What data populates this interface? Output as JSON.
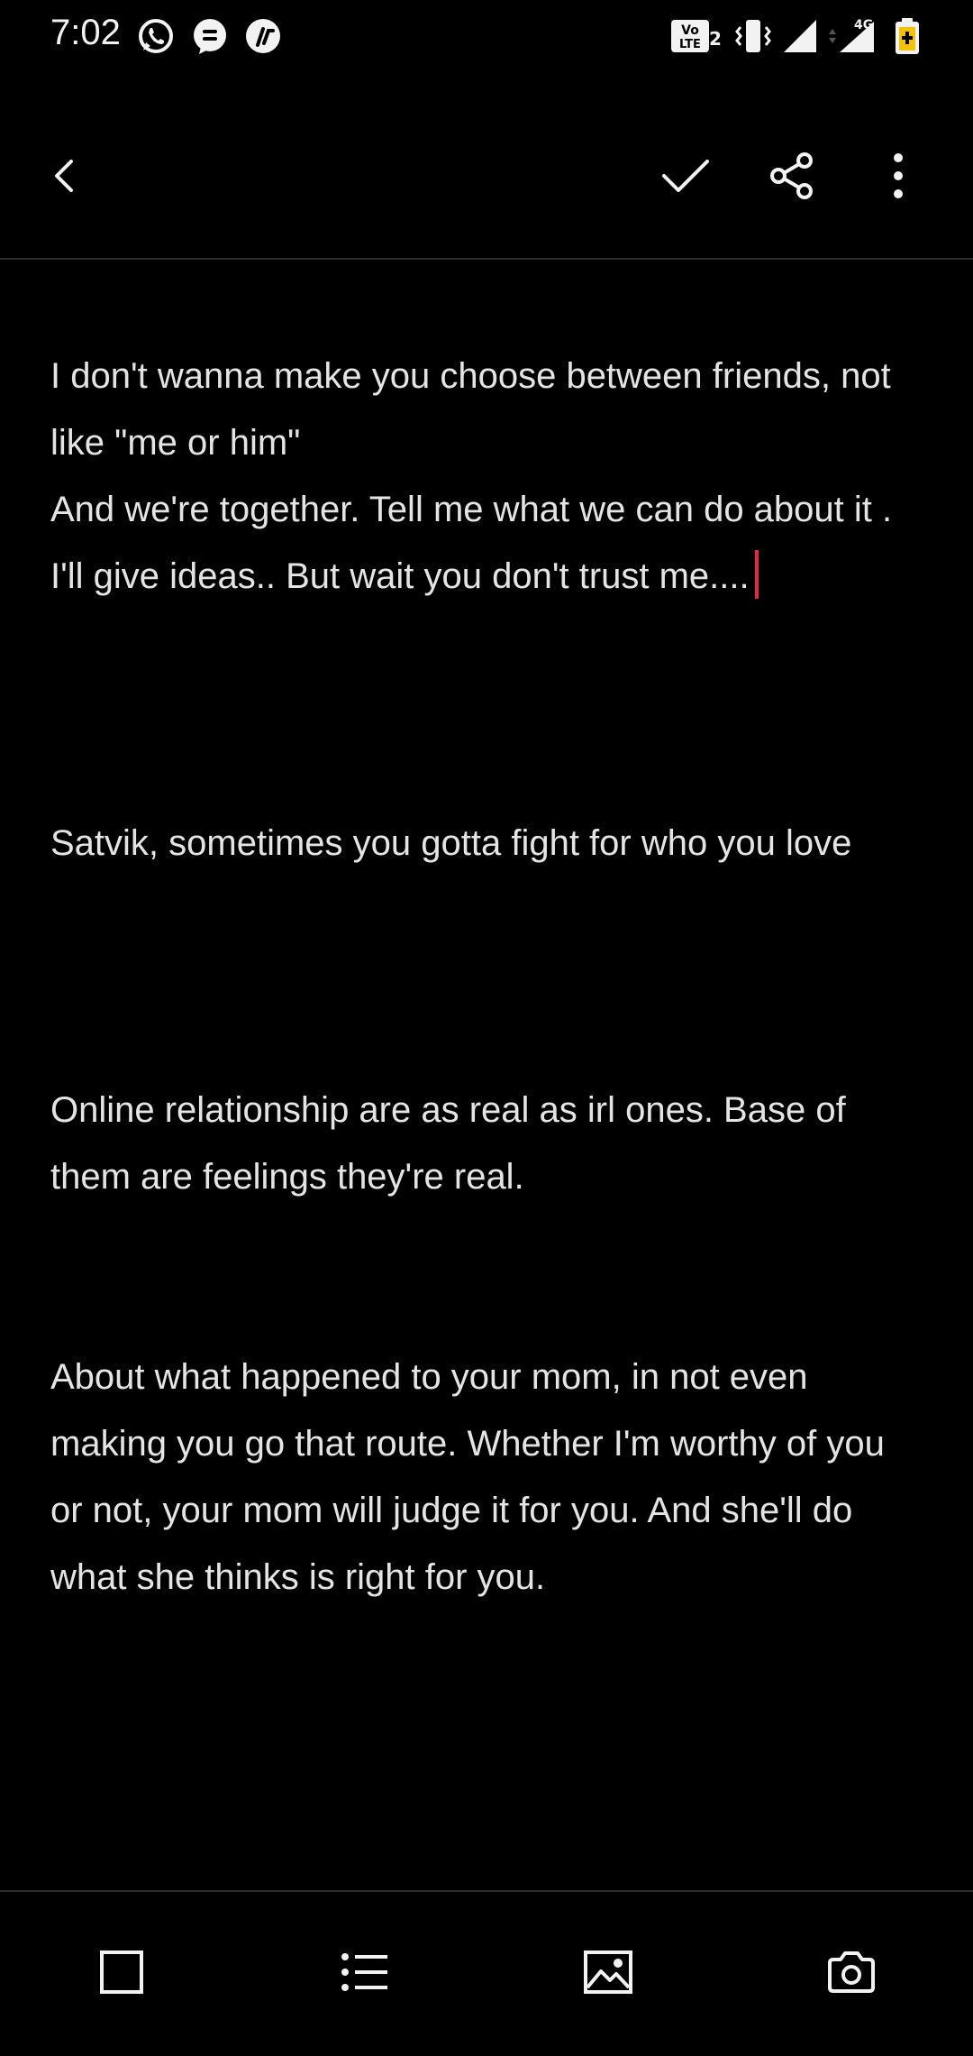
{
  "status_bar": {
    "time": "7:02",
    "left_icons": [
      "whatsapp-icon",
      "message-icon",
      "app-icon"
    ],
    "right_icons": [
      "volte-icon",
      "vibrate-icon",
      "signal-icon",
      "signal-4g-icon",
      "battery-icon"
    ],
    "network_label": "4G",
    "volte_label": "Vo LTE 2"
  },
  "toolbar": {
    "back_icon": "back-arrow-icon",
    "done_icon": "check-icon",
    "share_icon": "share-icon",
    "more_icon": "more-vert-icon"
  },
  "note": {
    "paragraphs": [
      "I don't wanna make you choose between friends, not like \"me or him\"\nAnd we're together. Tell me what we can do about it . I'll give ideas.. But wait you don't trust me....",
      "Satvik, sometimes you gotta fight for who you love",
      "Online relationship are as real as irl ones. Base of them are feelings they're real.",
      "About what happened to your mom, in not even making you go that route. Whether I'm worthy of you or not, your mom will judge it for you. And she'll do what she thinks is right for you."
    ],
    "caret_color": "#e0294a"
  },
  "bottom_bar": {
    "icons": [
      "checkbox-icon",
      "bulleted-list-icon",
      "image-icon",
      "camera-icon"
    ]
  }
}
